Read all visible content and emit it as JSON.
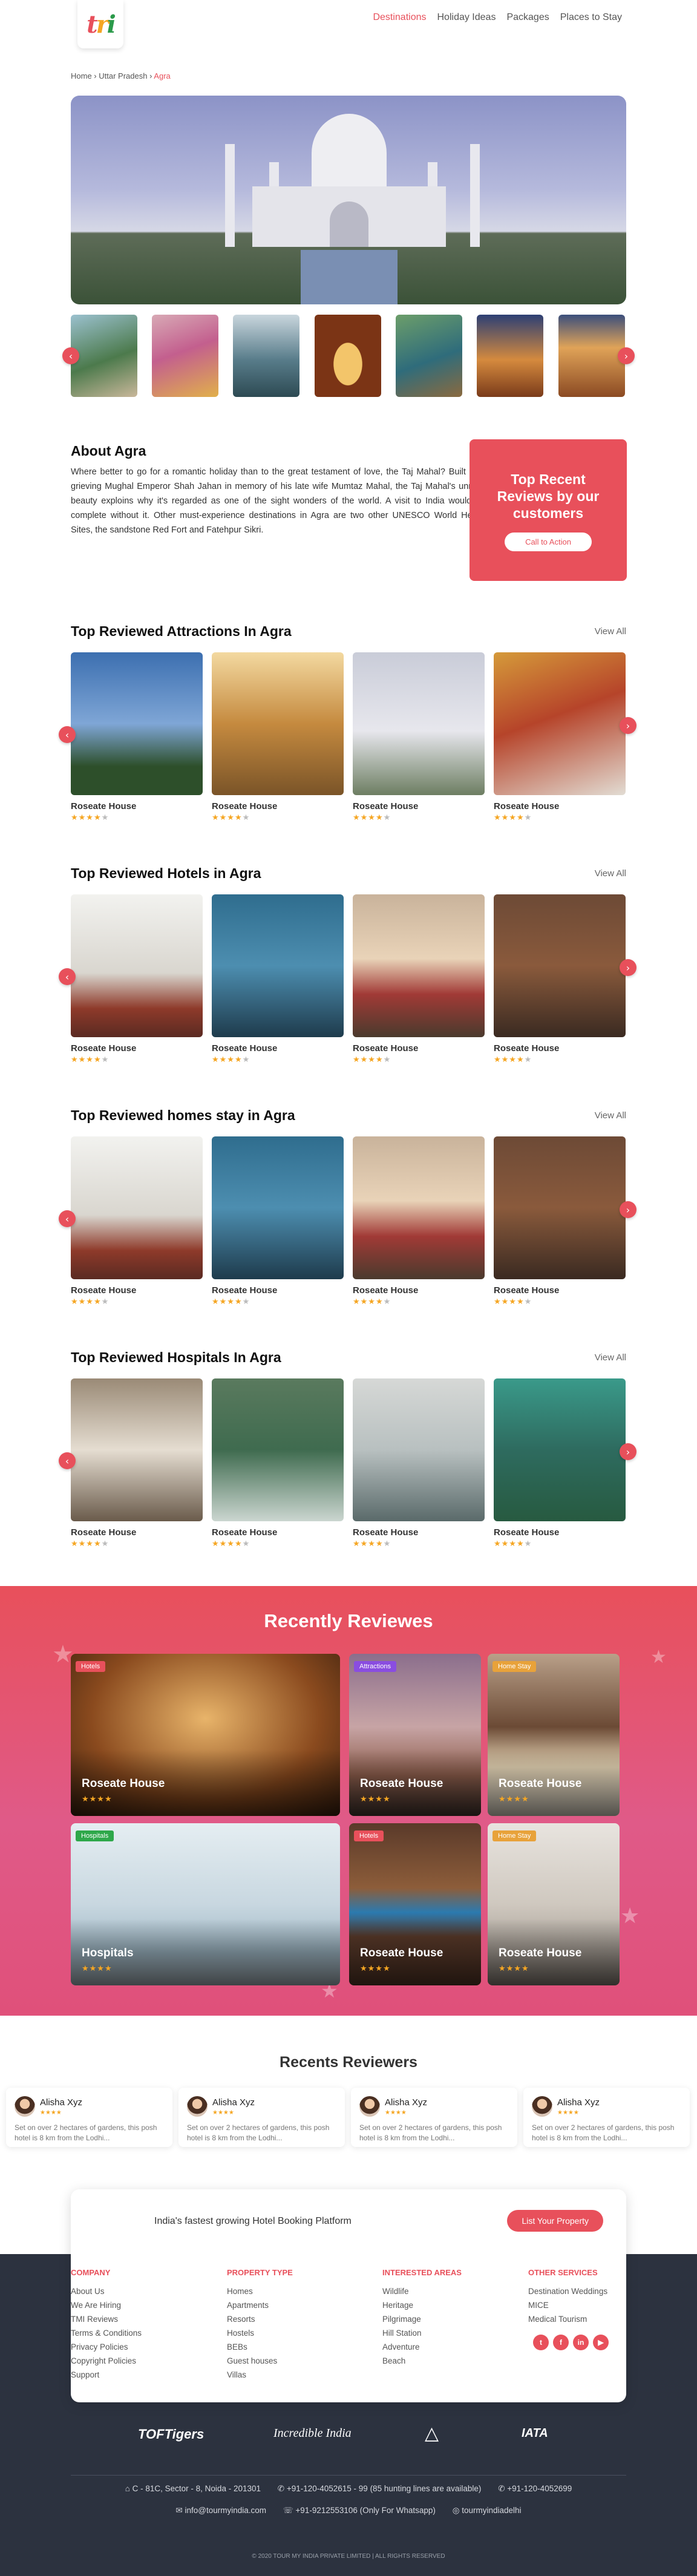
{
  "header": {
    "logo_letters": [
      "t",
      "r",
      "i"
    ],
    "nav": [
      {
        "label": "Destinations",
        "active": true
      },
      {
        "label": "Holiday Ideas"
      },
      {
        "label": "Packages"
      },
      {
        "label": "Places to Stay"
      }
    ]
  },
  "breadcrumb": {
    "items": [
      "Home",
      "Uttar Pradesh"
    ],
    "current": "Agra"
  },
  "gallery": {
    "prev": "‹",
    "next": "›"
  },
  "about": {
    "title": "About Agra",
    "text": "Where better to go for a romantic holiday than to the great testament of love, the Taj Mahal? Built by the grieving Mughal Emperor Shah Jahan in memory of his late wife Mumtaz Mahal, the Taj Mahal's unrivaled beauty exploins why it's regarded as one of the sight wonders of the world. A visit to India wouldn't be complete without it. Other must-experience destinations in Agra are two other UNESCO World Heritage Sites, the sandstone Red Fort and Fatehpur Sikri."
  },
  "cta": {
    "title": "Top Recent Reviews by our customers",
    "button": "Call to Action"
  },
  "sections": [
    {
      "title": "Top Reviewed Attractions In Agra",
      "view_all": "View All",
      "cards": [
        "Roseate House",
        "Roseate House",
        "Roseate House",
        "Roseate House"
      ]
    },
    {
      "title": "Top Reviewed Hotels in Agra",
      "view_all": "View All",
      "cards": [
        "Roseate House",
        "Roseate House",
        "Roseate House",
        "Roseate House"
      ]
    },
    {
      "title": "Top Reviewed homes stay in Agra",
      "view_all": "View All",
      "cards": [
        "Roseate House",
        "Roseate House",
        "Roseate House",
        "Roseate House"
      ]
    },
    {
      "title": "Top Reviewed Hospitals In Agra",
      "view_all": "View All",
      "cards": [
        "Roseate House",
        "Roseate House",
        "Roseate House",
        "Roseate House"
      ]
    }
  ],
  "rating": {
    "filled": "★★★★",
    "empty": "★"
  },
  "recent": {
    "title": "Recently Reviewes",
    "cards": [
      {
        "tag": "Hotels",
        "name": "Roseate House"
      },
      {
        "tag": "Attractions",
        "name": "Roseate House"
      },
      {
        "tag": "Home Stay",
        "name": "Roseate House"
      },
      {
        "tag": "Hospitals",
        "name": "Hospitals"
      },
      {
        "tag": "Hotels",
        "name": "Roseate House"
      },
      {
        "tag": "Home Stay",
        "name": "Roseate House"
      }
    ]
  },
  "reviewers": {
    "title": "Recents Reviewers",
    "items": [
      {
        "name": "Alisha Xyz",
        "text": "Set on over 2 hectares of gardens, this posh hotel is 8 km from the Lodhi..."
      },
      {
        "name": "Alisha Xyz",
        "text": "Set on over 2 hectares of gardens, this posh hotel is 8 km from the Lodhi..."
      },
      {
        "name": "Alisha Xyz",
        "text": "Set on over 2 hectares of gardens, this posh hotel is 8 km from the Lodhi..."
      },
      {
        "name": "Alisha Xyz",
        "text": "Set on over 2 hectares of gardens, this posh hotel is 8 km from the Lodhi..."
      }
    ]
  },
  "footer": {
    "tagline": "India's fastest growing Hotel Booking Platform",
    "list_button": "List Your Property",
    "columns": [
      {
        "head": "COMPANY",
        "items": [
          "About Us",
          "We Are Hiring",
          "TMI Reviews",
          "Terms & Conditions",
          "Privacy Policies",
          "Copyright Policies",
          "Support"
        ]
      },
      {
        "head": "PROPERTY TYPE",
        "items": [
          "Homes",
          "Apartments",
          "Resorts",
          "Hostels",
          "BEBs",
          "Guest houses",
          "Villas"
        ]
      },
      {
        "head": "INTERESTED AREAS",
        "items": [
          "Wildlife",
          "Heritage",
          "Pilgrimage",
          "Hill Station",
          "Adventure",
          "Beach"
        ]
      },
      {
        "head": "OTHER SERVICES",
        "items": [
          "Destination Weddings",
          "MICE",
          "Medical Tourism"
        ]
      }
    ],
    "social": [
      "t",
      "f",
      "in",
      "▶"
    ],
    "partners": [
      "TOFTigers",
      "Incredible India",
      "IATA"
    ],
    "address": "C - 81C, Sector - 8, Noida - 201301",
    "phone1": "+91-120-4052615 - 99 (85 hunting lines are available)",
    "phone2": "+91-120-4052699",
    "email": "info@tourmyindia.com",
    "whatsapp": "+91-9212553106 (Only For Whatsapp)",
    "handle": "tourmyindiadelhi",
    "copyright": "© 2020 TOUR MY INDIA PRIVATE LIMITED | ALL RIGHTS RESERVED"
  },
  "colors": {
    "accent": "#e8505b",
    "star": "#f5a623",
    "footer_bg": "#2c323f"
  }
}
